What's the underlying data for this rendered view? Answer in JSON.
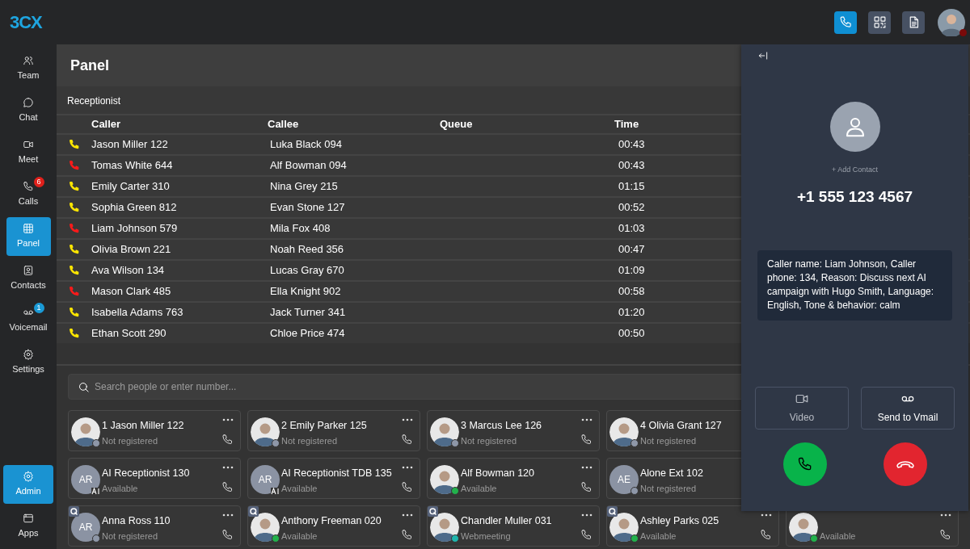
{
  "logo": "3CX",
  "top_icons": [
    {
      "kind": "phone",
      "active": true
    },
    {
      "kind": "qr",
      "active": false
    },
    {
      "kind": "document",
      "active": false
    }
  ],
  "user": {
    "color": "#7a0a0a"
  },
  "sidebar": {
    "items": [
      {
        "kind": "team",
        "label": "Team",
        "selected": false
      },
      {
        "kind": "chat",
        "label": "Chat",
        "selected": false
      },
      {
        "kind": "meet",
        "label": "Meet",
        "selected": false
      },
      {
        "kind": "calls",
        "label": "Calls",
        "selected": false,
        "badge": "6",
        "color": "#e0201b"
      },
      {
        "kind": "panel",
        "label": "Panel",
        "selected": true
      },
      {
        "kind": "contacts",
        "label": "Contacts",
        "selected": false
      },
      {
        "kind": "voicemail",
        "label": "Voicemail",
        "selected": false,
        "badge": "1",
        "color": "#1a9ad6"
      },
      {
        "kind": "settings",
        "label": "Settings",
        "selected": false
      }
    ],
    "bottom_items": [
      {
        "kind": "admin",
        "label": "Admin",
        "selected": true
      },
      {
        "kind": "apps",
        "label": "Apps",
        "selected": false
      }
    ]
  },
  "page_title": "Panel",
  "table": {
    "title": "Receptionist",
    "columns": [
      "Caller",
      "Callee",
      "Queue",
      "Time"
    ],
    "rows": [
      {
        "color": "#ffe600",
        "caller": "Jason Miller 122",
        "callee": "Luka Black 094",
        "time": "00:43"
      },
      {
        "color": "#ff1a1a",
        "caller": "Tomas White 644",
        "callee": "Alf Bowman 094",
        "time": "00:43"
      },
      {
        "color": "#ffe600",
        "caller": "Emily Carter 310",
        "callee": "Nina Grey 215",
        "time": "01:15"
      },
      {
        "color": "#ffe600",
        "caller": "Sophia Green 812",
        "callee": "Evan Stone 127",
        "time": "00:52"
      },
      {
        "color": "#ff1a1a",
        "caller": "Liam Johnson 579",
        "callee": "Mila Fox 408",
        "time": "01:03"
      },
      {
        "color": "#ffe600",
        "caller": "Olivia Brown 221",
        "callee": "Noah Reed 356",
        "time": "00:47"
      },
      {
        "color": "#ffe600",
        "caller": "Ava Wilson 134",
        "callee": "Lucas Gray 670",
        "time": "01:09"
      },
      {
        "color": "#ff1a1a",
        "caller": "Mason Clark 485",
        "callee": "Ella Knight 902",
        "time": "00:58"
      },
      {
        "color": "#ffe600",
        "caller": "Isabella Adams 763",
        "callee": "Jack Turner 341",
        "time": "01:20"
      },
      {
        "color": "#ffe600",
        "caller": "Ethan Scott 290",
        "callee": "Chloe Price 474",
        "time": "00:50"
      }
    ]
  },
  "search": {
    "placeholder": "Search people or enter number..."
  },
  "contact_rows": [
    [
      {
        "kind": "photo",
        "name": "1 Jason Miller 122",
        "status": "Not registered",
        "color": "#8e97a8",
        "queue": false,
        "ai": false
      },
      {
        "kind": "photo",
        "name": "2 Emily Parker 125",
        "status": "Not registered",
        "color": "#8e97a8",
        "queue": false,
        "ai": false
      },
      {
        "kind": "photo",
        "name": "3 Marcus Lee 126",
        "status": "Not registered",
        "color": "#8e97a8",
        "queue": false,
        "ai": false
      },
      {
        "kind": "photo",
        "name": "4 Olivia Grant 127",
        "status": "Not registered",
        "color": "#8e97a8",
        "queue": false,
        "ai": false
      }
    ],
    [
      {
        "kind": "initials",
        "initials": "AR",
        "name": "AI Receptionist 130",
        "status": "Available",
        "queue": false,
        "ai": true
      },
      {
        "kind": "initials",
        "initials": "AR",
        "name": "AI Receptionist TDB 135",
        "status": "Available",
        "queue": false,
        "ai": true
      },
      {
        "kind": "photo",
        "name": "Alf Bowman 120",
        "status": "Available",
        "color": "#22b14c",
        "queue": false,
        "ai": false
      },
      {
        "kind": "initials",
        "initials": "AE",
        "name": "Alone Ext 102",
        "status": "Not registered",
        "color": "#8e97a8",
        "queue": false,
        "ai": false
      }
    ],
    [
      {
        "kind": "initials",
        "initials": "AR",
        "name": "Anna Ross 110",
        "status": "Not registered",
        "color": "#8e97a8",
        "queue": true,
        "ai": false
      },
      {
        "kind": "photo",
        "name": "Anthony Freeman 020",
        "status": "Available",
        "color": "#22b14c",
        "queue": true,
        "ai": false
      },
      {
        "kind": "photo",
        "name": "Chandler Muller 031",
        "status": "Webmeeting",
        "color": "#1fb5ad",
        "queue": true,
        "ai": false
      },
      {
        "kind": "photo",
        "name": "Ashley Parks 025",
        "status": "Available",
        "color": "#22b14c",
        "queue": true,
        "ai": false
      },
      {
        "kind": "photo",
        "status": "Available",
        "color": "#22b14c",
        "queue": false,
        "ai": false
      }
    ]
  ],
  "call": {
    "add_contact": "+ Add Contact",
    "number": "+1 555 123 4567",
    "note": "Caller name: Liam Johnson, Caller phone: 134, Reason: Discuss next AI campaign with Hugo Smith, Language: English, Tone & behavior: calm",
    "actions": [
      {
        "kind": "video",
        "label": "Video",
        "disabled": true
      },
      {
        "kind": "vmail",
        "label": "Send to Vmail",
        "disabled": false
      }
    ]
  }
}
